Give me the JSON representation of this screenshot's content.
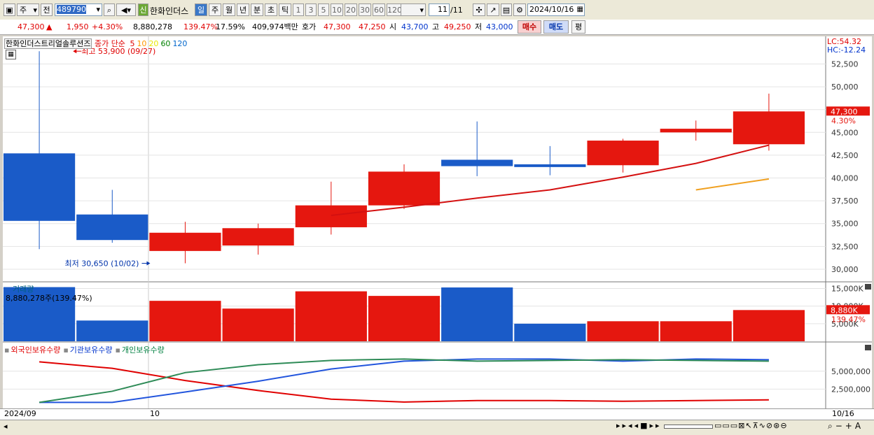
{
  "toolbar": {
    "period_type": "주",
    "prev_label": "전",
    "code": "489790",
    "stock_badge": "신",
    "stock_name": "한화인더스",
    "periods": [
      "일",
      "주",
      "월",
      "년",
      "분",
      "초",
      "틱"
    ],
    "selected_period": "일",
    "intervals": [
      "1",
      "3",
      "5",
      "10",
      "20",
      "30",
      "60",
      "120"
    ],
    "count": "11",
    "count_total": "/11",
    "date": "2024/10/16"
  },
  "quote": {
    "price": "47,300",
    "arrow": "▲",
    "change": "1,950",
    "change_pct": "+4.30%",
    "volume": "8,880,278",
    "volume_ratio": "139.47%",
    "turnover": "17.59%",
    "amount": "409,974백만",
    "ask_label": "호가",
    "ask1": "47,300",
    "ask2": "47,250",
    "open_label": "시",
    "open": "43,700",
    "high_label": "고",
    "high": "49,250",
    "low_label": "저",
    "low": "43,000",
    "buy_label": "매수",
    "sell_label": "매도",
    "eval_label": "평"
  },
  "price_panel": {
    "stock_title": "한화인더스트리얼솔루션즈",
    "ma_label": "종가 단순",
    "ma_periods": [
      {
        "label": "5",
        "color": "#e00000"
      },
      {
        "label": "10",
        "color": "#ff9900"
      },
      {
        "label": "20",
        "color": "#e8e800"
      },
      {
        "label": "60",
        "color": "#008000"
      },
      {
        "label": "120",
        "color": "#0066cc"
      }
    ],
    "high_note": "최고 53,900 (09/27)",
    "low_note": "최저 30,650 (10/02)",
    "lc": "LC:54.32",
    "hc": "HC:-12.24",
    "current_price": "47,300",
    "current_pct": "4.30%"
  },
  "volume_panel": {
    "title": "거래량",
    "value_text": "8,880,278주(139.47%)",
    "current": "8,880K",
    "current_pct": "139.47%"
  },
  "holdings_panel": {
    "legend": [
      {
        "label": "외국인보유수량",
        "color": "#e00000"
      },
      {
        "label": "기관보유수량",
        "color": "#0033cc"
      },
      {
        "label": "개인보유수량",
        "color": "#008040"
      }
    ]
  },
  "x_axis": {
    "left": "2024/09",
    "mid": "10",
    "right": "10/16"
  },
  "chart_data": [
    {
      "type": "candlestick",
      "title": "한화인더스트리얼솔루션즈",
      "ylim": [
        29000,
        54300
      ],
      "yticks": [
        30000,
        32500,
        35000,
        37500,
        40000,
        42500,
        45000,
        47500,
        50000,
        52500
      ],
      "ytick_labels": [
        "30,000",
        "32,500",
        "35,000",
        "37,500",
        "40,000",
        "42,500",
        "45,000",
        "47,500",
        "50,000",
        "52,500"
      ],
      "candles": [
        {
          "open": 42700,
          "high": 53900,
          "low": 32200,
          "close": 35300
        },
        {
          "open": 36000,
          "high": 38700,
          "low": 32900,
          "close": 33200
        },
        {
          "open": 32000,
          "high": 35200,
          "low": 30650,
          "close": 34000
        },
        {
          "open": 32600,
          "high": 35000,
          "low": 31600,
          "close": 34500
        },
        {
          "open": 34600,
          "high": 39600,
          "low": 33800,
          "close": 37000
        },
        {
          "open": 37000,
          "high": 41500,
          "low": 36600,
          "close": 40700
        },
        {
          "open": 42000,
          "high": 46200,
          "low": 40200,
          "close": 41300
        },
        {
          "open": 41500,
          "high": 43500,
          "low": 40300,
          "close": 41200
        },
        {
          "open": 41400,
          "high": 44300,
          "low": 40600,
          "close": 44100
        },
        {
          "open": 45000,
          "high": 46300,
          "low": 44100,
          "close": 45400
        },
        {
          "open": 43700,
          "high": 49250,
          "low": 43000,
          "close": 47300
        }
      ],
      "ma5": [
        null,
        null,
        null,
        null,
        35900,
        36800,
        37800,
        38700,
        40100,
        41600,
        43600
      ],
      "ma10": [
        null,
        null,
        null,
        null,
        null,
        null,
        null,
        null,
        null,
        38700,
        39900
      ]
    },
    {
      "type": "bar",
      "title": "거래량",
      "ylim": [
        0,
        16500
      ],
      "yticks": [
        5000,
        10000,
        15000
      ],
      "ytick_labels": [
        "5,000K",
        "10,000K",
        "15,000K"
      ],
      "values": [
        15400,
        5900,
        11500,
        9300,
        14200,
        12900,
        15300,
        5000,
        5700,
        5700,
        8880
      ],
      "colors": [
        "blue",
        "blue",
        "red",
        "red",
        "red",
        "red",
        "blue",
        "blue",
        "red",
        "red",
        "red"
      ]
    },
    {
      "type": "line",
      "title": "보유수량",
      "ylim": [
        0,
        8000000
      ],
      "yticks": [
        2500000,
        5000000
      ],
      "ytick_labels": [
        "2,500,000",
        "5,000,000"
      ],
      "series": [
        {
          "name": "외국인보유수량",
          "values": [
            6300000,
            5400000,
            3700000,
            2300000,
            1100000,
            700000,
            900000,
            900000,
            800000,
            900000,
            1000000
          ]
        },
        {
          "name": "기관보유수량",
          "values": [
            650000,
            650000,
            2100000,
            3600000,
            5300000,
            6400000,
            6700000,
            6700000,
            6400000,
            6700000,
            6600000
          ]
        },
        {
          "name": "개인보유수량",
          "values": [
            650000,
            2200000,
            4800000,
            5900000,
            6500000,
            6700000,
            6400000,
            6500000,
            6600000,
            6500000,
            6400000
          ]
        }
      ]
    }
  ]
}
